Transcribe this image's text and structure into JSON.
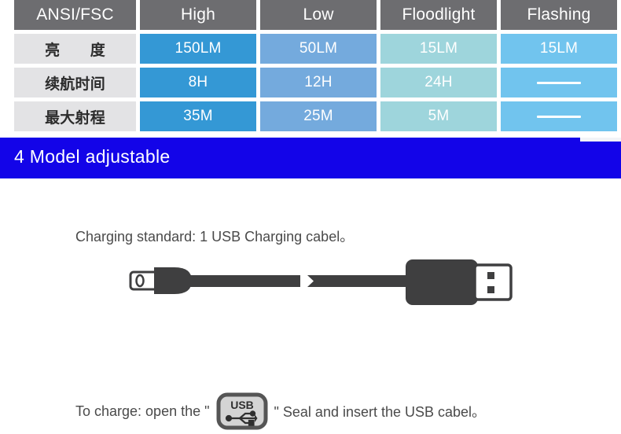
{
  "spec_table": {
    "headers": [
      "ANSI/FSC",
      "High",
      "Low",
      "Floodlight",
      "Flashing"
    ],
    "rows": [
      {
        "label": "亮　　度",
        "values": [
          "150LM",
          "50LM",
          "15LM",
          "15LM"
        ]
      },
      {
        "label": "续航时间",
        "values": [
          "8H",
          "12H",
          "24H",
          "—"
        ]
      },
      {
        "label": "最大射程",
        "values": [
          "35M",
          "25M",
          "5M",
          "—"
        ]
      }
    ],
    "colors": {
      "header_bg": "#6d6d70",
      "label_bg": "#e3e3e5",
      "high_bg": "#3498d5",
      "low_bg": "#74aadd",
      "floodlight_bg": "#9ed5dc",
      "flashing_bg": "#71c4ee",
      "value_text": "#ffffff",
      "label_text": "#2c2c2c"
    }
  },
  "banner": {
    "title": "4 Model adjustable",
    "bg_color": "#1304e8",
    "text_color": "#ffffff"
  },
  "charging": {
    "standard_text": "Charging standard: 1 USB Charging cabel。",
    "to_charge_prefix": "To charge: open the \"",
    "to_charge_suffix": "\" Seal and insert the USB cabel。",
    "usb_icon_label": "USB",
    "cable_icon_name": "usb-charging-cable-illustration"
  }
}
